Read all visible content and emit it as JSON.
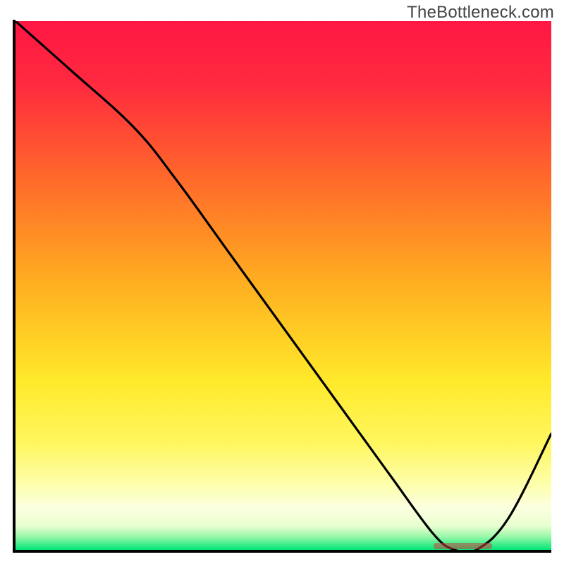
{
  "watermark": "TheBottleneck.com",
  "colors": {
    "gradient_stops": [
      {
        "offset": 0.0,
        "color": "#ff1744"
      },
      {
        "offset": 0.12,
        "color": "#ff2a3f"
      },
      {
        "offset": 0.3,
        "color": "#ff6a2a"
      },
      {
        "offset": 0.5,
        "color": "#ffb020"
      },
      {
        "offset": 0.68,
        "color": "#ffe92a"
      },
      {
        "offset": 0.8,
        "color": "#fff760"
      },
      {
        "offset": 0.88,
        "color": "#fdffb0"
      },
      {
        "offset": 0.92,
        "color": "#fcffe0"
      },
      {
        "offset": 0.955,
        "color": "#e8ffd0"
      },
      {
        "offset": 0.975,
        "color": "#98f7a8"
      },
      {
        "offset": 1.0,
        "color": "#00e676"
      }
    ],
    "curve": "#000000",
    "marker": "rgba(200,64,64,0.55)",
    "axis": "#000000"
  },
  "chart_data": {
    "type": "line",
    "title": "",
    "xlabel": "",
    "ylabel": "",
    "xlim": [
      0,
      100
    ],
    "ylim": [
      0,
      100
    ],
    "grid": false,
    "legend": false,
    "series": [
      {
        "name": "bottleneck-curve",
        "x": [
          0,
          10,
          22,
          30,
          40,
          50,
          60,
          70,
          78,
          82,
          86,
          92,
          100
        ],
        "values": [
          100,
          91,
          80,
          70,
          56,
          42,
          28,
          14,
          3,
          0,
          0,
          6,
          22
        ]
      }
    ],
    "annotations": [
      {
        "name": "min-plateau-marker",
        "x_start": 78,
        "x_end": 89,
        "y": 0.8
      }
    ]
  }
}
